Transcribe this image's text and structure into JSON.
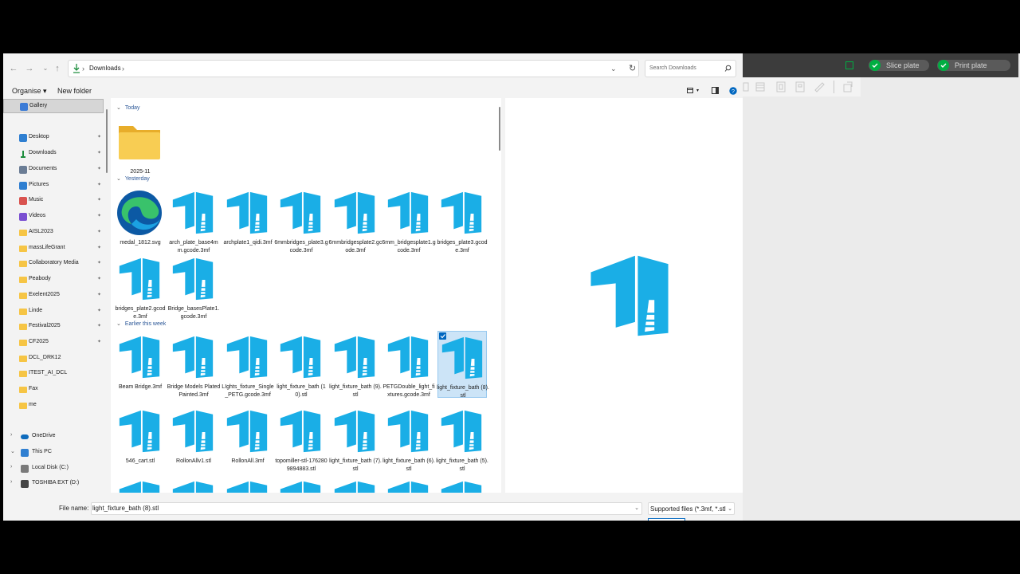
{
  "background_app": {
    "slice_label": "Slice plate",
    "print_label": "Print plate",
    "accent": "#00ae42"
  },
  "dialog": {
    "address": {
      "path": "Downloads",
      "separator": "›"
    },
    "search": {
      "placeholder": "Search Downloads"
    },
    "commands": {
      "organise": "Organise ▾",
      "new_folder": "New folder"
    },
    "nav": {
      "items": [
        {
          "label": "Gallery",
          "icon": "gallery-icon",
          "selected": true
        },
        {
          "label": "Desktop",
          "icon": "desktop-icon",
          "pinned": true
        },
        {
          "label": "Downloads",
          "icon": "download-icon",
          "pinned": true
        },
        {
          "label": "Documents",
          "icon": "documents-icon",
          "pinned": true
        },
        {
          "label": "Pictures",
          "icon": "pictures-icon",
          "pinned": true
        },
        {
          "label": "Music",
          "icon": "music-icon",
          "pinned": true
        },
        {
          "label": "Videos",
          "icon": "videos-icon",
          "pinned": true
        },
        {
          "label": "AISL2023",
          "icon": "folder-icon",
          "pinned": true
        },
        {
          "label": "massLifeGrant",
          "icon": "folder-icon",
          "pinned": true
        },
        {
          "label": "Collaboratory Media",
          "icon": "folder-icon",
          "pinned": true
        },
        {
          "label": "Peabody",
          "icon": "folder-icon",
          "pinned": true
        },
        {
          "label": "Exelent2025",
          "icon": "folder-icon",
          "pinned": true
        },
        {
          "label": "Linde",
          "icon": "folder-icon",
          "pinned": true
        },
        {
          "label": "Festival2025",
          "icon": "folder-icon",
          "pinned": true
        },
        {
          "label": "CF2025",
          "icon": "folder-icon",
          "pinned": true
        },
        {
          "label": "DCL_DRK12",
          "icon": "folder-icon"
        },
        {
          "label": "ITEST_AI_DCL",
          "icon": "folder-icon"
        },
        {
          "label": "Fax",
          "icon": "folder-icon"
        },
        {
          "label": "me",
          "icon": "folder-icon"
        },
        {
          "label": "OneDrive",
          "icon": "cloud-icon",
          "expander": "›"
        },
        {
          "label": "This PC",
          "icon": "pc-icon",
          "expander": "⌄"
        },
        {
          "label": "Local Disk (C:)",
          "icon": "disk-icon",
          "expander": "›"
        },
        {
          "label": "TOSHIBA EXT (D:)",
          "icon": "usb-drive-icon",
          "expander": "›"
        }
      ],
      "pin_glyph": "📌"
    },
    "groups": {
      "today": "Today",
      "yesterday": "Yesterday",
      "earlier": "Earlier this week"
    },
    "files": {
      "today": [
        {
          "name": "2025-11",
          "kind": "folder"
        }
      ],
      "yesterday": [
        {
          "name": "medal_1812.svg",
          "kind": "edge"
        },
        {
          "name": "arch_plate_base4mm.gcode.3mf",
          "kind": "bambu"
        },
        {
          "name": "archplate1_qidi.3mf",
          "kind": "bambu"
        },
        {
          "name": "6mmbridges_plate3.gcode.3mf",
          "kind": "bambu"
        },
        {
          "name": "6mmbridgesplate2.gcode.3mf",
          "kind": "bambu"
        },
        {
          "name": "6mm_bridgesplate1.gcode.3mf",
          "kind": "bambu"
        },
        {
          "name": "bridges_plate3.gcode.3mf",
          "kind": "bambu"
        },
        {
          "name": "bridges_plate2.gcode.3mf",
          "kind": "bambu"
        },
        {
          "name": "Bridge_basesPlate1.gcode.3mf",
          "kind": "bambu"
        }
      ],
      "earlier": [
        {
          "name": "Beam Bridge.3mf",
          "kind": "bambu"
        },
        {
          "name": "Bridge Models Plated Painted.3mf",
          "kind": "bambu"
        },
        {
          "name": "LIghts_fixture_Single_PETG.gcode.3mf",
          "kind": "bambu"
        },
        {
          "name": "light_fixture_bath (10).stl",
          "kind": "bambu"
        },
        {
          "name": "light_fixture_bath (9).stl",
          "kind": "bambu"
        },
        {
          "name": "PETGDouble_light_fixtures.gcode.3mf",
          "kind": "bambu"
        },
        {
          "name": "light_fixture_bath (8).stl",
          "kind": "bambu",
          "selected": true
        },
        {
          "name": "546_cart.stl",
          "kind": "bambu"
        },
        {
          "name": "RollonAllv1.stl",
          "kind": "bambu"
        },
        {
          "name": "RollonAll.3mf",
          "kind": "bambu"
        },
        {
          "name": "topomiller-stl-1762809894883.stl",
          "kind": "bambu"
        },
        {
          "name": "light_fixture_bath (7).stl",
          "kind": "bambu"
        },
        {
          "name": "light_fixture_bath (6).stl",
          "kind": "bambu"
        },
        {
          "name": "light_fixture_bath (5).stl",
          "kind": "bambu"
        }
      ]
    },
    "bottom": {
      "file_name_label": "File name:",
      "file_name_value": "light_fixture_bath (8).stl",
      "file_type": "Supported files (*.3mf, *.stl"
    },
    "colors": {
      "bambu_blue": "#1aaee6",
      "selection": "#cce4f7",
      "folder": "#f6c545"
    }
  }
}
